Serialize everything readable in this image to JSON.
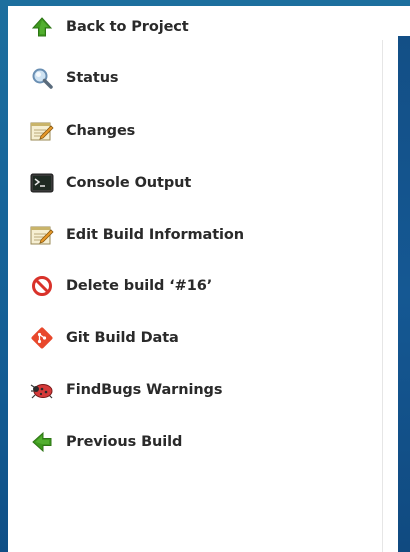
{
  "sidebar": {
    "items": [
      {
        "label": "Back to Project",
        "icon": "up-arrow-icon"
      },
      {
        "label": "Status",
        "icon": "magnifier-icon"
      },
      {
        "label": "Changes",
        "icon": "notepad-icon"
      },
      {
        "label": "Console Output",
        "icon": "terminal-icon"
      },
      {
        "label": "Edit Build Information",
        "icon": "notepad-icon"
      },
      {
        "label": "Delete build ‘#16’",
        "icon": "no-entry-icon"
      },
      {
        "label": "Git Build Data",
        "icon": "git-icon"
      },
      {
        "label": "FindBugs Warnings",
        "icon": "bug-icon"
      },
      {
        "label": "Previous Build",
        "icon": "left-arrow-icon"
      }
    ]
  },
  "colors": {
    "background_blue": "#155893",
    "panel": "#ffffff",
    "text": "#2a2a2a",
    "green_arrow": "#3f9a1f",
    "delete_red": "#d9322a",
    "git_orange": "#e8482c"
  }
}
